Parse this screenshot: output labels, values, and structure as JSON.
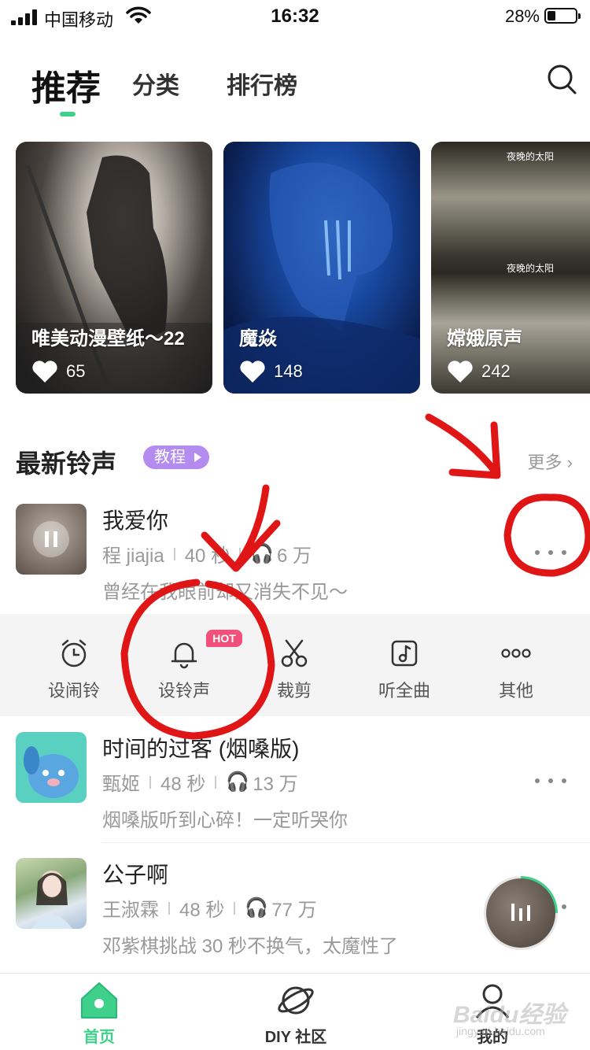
{
  "status_bar": {
    "carrier": "中国移动",
    "time": "16:32",
    "battery": "28%"
  },
  "tabs": [
    {
      "label": "推荐",
      "active": true
    },
    {
      "label": "分类",
      "active": false
    },
    {
      "label": "排行榜",
      "active": false
    }
  ],
  "cards": [
    {
      "title": "唯美动漫壁纸～22",
      "likes": "65"
    },
    {
      "title": "魔焱",
      "likes": "148"
    },
    {
      "title": "嫦娥原声",
      "likes": "242",
      "overlay_text": "夜晚的太阳"
    }
  ],
  "section": {
    "title": "最新铃声",
    "badge": "教程",
    "more": "更多 ›"
  },
  "ringtones": [
    {
      "title": "我爱你",
      "artist": "程 jiajia",
      "duration": "40 秒",
      "plays": "6 万",
      "desc": "曾经在我眼前却又消失不见～",
      "playing": true
    },
    {
      "title": "时间的过客 (烟嗓版)",
      "artist": "甄姬",
      "duration": "48 秒",
      "plays": "13 万",
      "desc": "烟嗓版听到心碎！一定听哭你",
      "playing": false
    },
    {
      "title": "公子啊",
      "artist": "王淑霖",
      "duration": "48 秒",
      "plays": "77 万",
      "desc": "邓紫棋挑战 30 秒不换气，太魔性了",
      "playing": false
    }
  ],
  "actions": [
    {
      "label": "设闹铃",
      "icon": "alarm-clock-icon"
    },
    {
      "label": "设铃声",
      "icon": "bell-icon",
      "badge": "HOT"
    },
    {
      "label": "裁剪",
      "icon": "scissors-icon"
    },
    {
      "label": "听全曲",
      "icon": "music-note-icon"
    },
    {
      "label": "其他",
      "icon": "more-circles-icon"
    }
  ],
  "bottom_nav": [
    {
      "label": "首页",
      "icon": "home-icon",
      "active": true
    },
    {
      "label": "DIY 社区",
      "icon": "planet-icon",
      "active": false
    },
    {
      "label": "我的",
      "icon": "user-icon",
      "active": false
    }
  ],
  "watermark": {
    "text": "Baidu经验",
    "sub": "jingyan.baidu.com"
  },
  "colors": {
    "accent": "#3fd18b",
    "badge_purple": "#b48cf0",
    "hot_pink": "#f0507a",
    "annotation_red": "#e01515"
  }
}
